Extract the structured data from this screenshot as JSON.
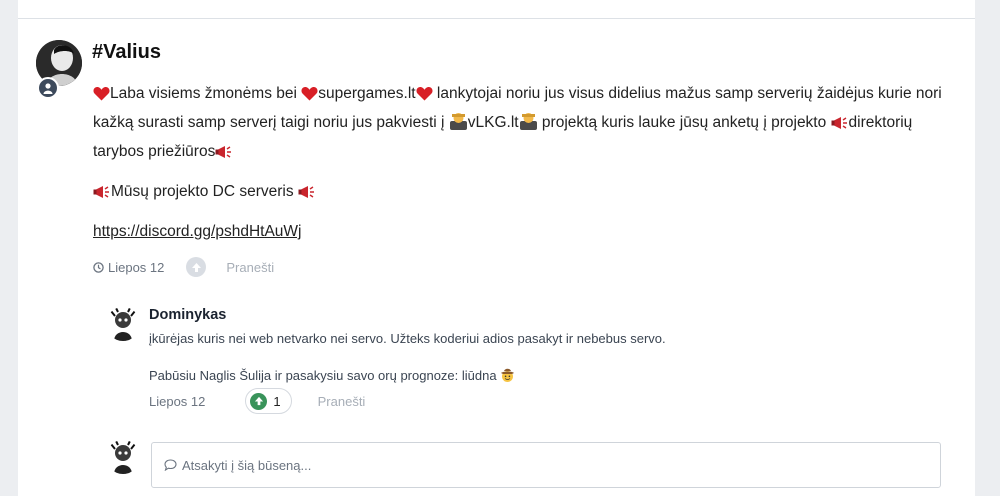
{
  "post": {
    "title": "#Valius",
    "paragraph1": {
      "t1": "Laba visiems žmonėms bei ",
      "t2": "supergames.lt",
      "t3": " lankytojai noriu jus visus didelius mažus samp serverių žaidėjus kurie nori kažką surasti samp serverį taigi noriu jus pakviesti į ",
      "t4": "vLKG.lt",
      "t5": " projektą kuris lauke jūsų anketų į projekto ",
      "t6": "direktorių tarybos priežiūros"
    },
    "paragraph2": "Mūsų projekto DC serveris ",
    "link": "https://discord.gg/pshdHtAuWj",
    "date": "Liepos 12",
    "report": "Pranešti"
  },
  "reply": {
    "author": "Dominykas",
    "line1": "įkūrėjas kuris nei web netvarko nei servo. Užteks koderiui adios pasakyt ir nebebus servo.",
    "line2": "Pabūsiu Naglis Šulija ir pasakysiu savo orų prognoze: liūdna ",
    "date": "Liepos 12",
    "reaction_count": "1",
    "report": "Pranešti"
  },
  "composer": {
    "placeholder": "Atsakyti į šią būseną..."
  },
  "icons": {
    "heart": "heart-icon",
    "megaphone": "megaphone-icon",
    "person": "person-icon",
    "clock": "clock-icon",
    "upvote": "upvote-icon",
    "comment": "comment-icon"
  },
  "colors": {
    "heart": "#d81f26",
    "upvote_active": "#39935a",
    "badge": "#3d4a5c"
  }
}
